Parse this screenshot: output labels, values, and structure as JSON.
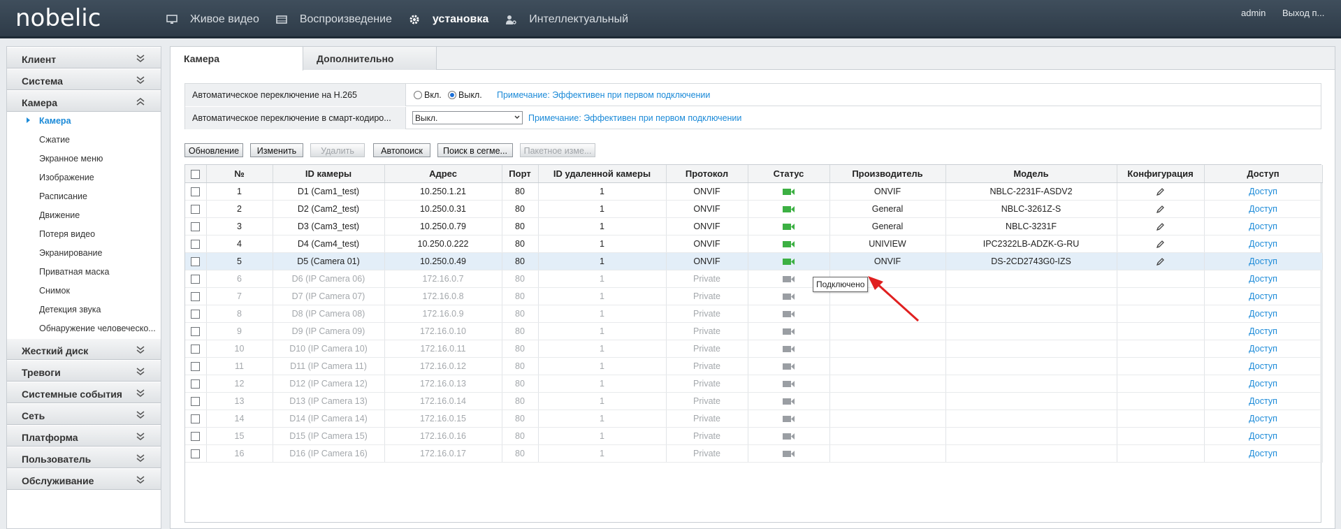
{
  "header": {
    "logo": "nobelic",
    "nav": [
      {
        "label": "Живое видео",
        "icon": "monitor-icon"
      },
      {
        "label": "Воспроизведение",
        "icon": "film-icon"
      },
      {
        "label": "установка",
        "icon": "gear-icon",
        "active": true
      },
      {
        "label": "Интеллектуальный",
        "icon": "user-settings-icon"
      }
    ],
    "user": "admin",
    "logout": "Выход п..."
  },
  "sidebar": {
    "sections_top": [
      {
        "label": "Клиент"
      },
      {
        "label": "Система"
      },
      {
        "label": "Камера",
        "expanded": true
      }
    ],
    "camera_items": [
      {
        "label": "Камера",
        "active": true
      },
      {
        "label": "Сжатие"
      },
      {
        "label": "Экранное меню"
      },
      {
        "label": "Изображение"
      },
      {
        "label": "Расписание"
      },
      {
        "label": "Движение"
      },
      {
        "label": "Потеря видео"
      },
      {
        "label": "Экранирование"
      },
      {
        "label": "Приватная маска"
      },
      {
        "label": "Снимок"
      },
      {
        "label": "Детекция звука"
      },
      {
        "label": "Обнаружение человеческо..."
      }
    ],
    "sections_bottom": [
      {
        "label": "Жесткий диск"
      },
      {
        "label": "Тревоги"
      },
      {
        "label": "Системные события"
      },
      {
        "label": "Сеть"
      },
      {
        "label": "Платформа"
      },
      {
        "label": "Пользователь"
      },
      {
        "label": "Обслуживание"
      }
    ]
  },
  "tabs": [
    {
      "label": "Камера",
      "active": true
    },
    {
      "label": "Дополнительно"
    }
  ],
  "options": {
    "h265_label": "Автоматическое переключение на H.265",
    "h265_on_label": "Вкл.",
    "h265_off_label": "Выкл.",
    "h265_value": "off",
    "h265_note": "Примечание: Эффективен при первом подключении",
    "smart_label": "Автоматическое переключение в смарт-кодиро...",
    "smart_value": "Выкл.",
    "smart_note": "Примечание: Эффективен при первом подключении"
  },
  "toolbar": {
    "refresh": "Обновление",
    "edit": "Изменить",
    "delete": "Удалить",
    "autosearch": "Автопоиск",
    "segment_search": "Поиск в сегме...",
    "batch_edit": "Пакетное изме..."
  },
  "table": {
    "columns": [
      "№",
      "ID камеры",
      "Адрес",
      "Порт",
      "ID удаленной камеры",
      "Протокол",
      "Статус",
      "Производитель",
      "Модель",
      "Конфигурация",
      "Доступ"
    ],
    "rows": [
      {
        "no": "1",
        "id": "D1 (Cam1_test)",
        "addr": "10.250.1.21",
        "port": "80",
        "remote": "1",
        "proto": "ONVIF",
        "online": true,
        "vendor": "ONVIF",
        "model": "NBLC-2231F-ASDV2",
        "config": true,
        "access": "Доступ"
      },
      {
        "no": "2",
        "id": "D2 (Cam2_test)",
        "addr": "10.250.0.31",
        "port": "80",
        "remote": "1",
        "proto": "ONVIF",
        "online": true,
        "vendor": "General",
        "model": "NBLC-3261Z-S",
        "config": true,
        "access": "Доступ"
      },
      {
        "no": "3",
        "id": "D3 (Cam3_test)",
        "addr": "10.250.0.79",
        "port": "80",
        "remote": "1",
        "proto": "ONVIF",
        "online": true,
        "vendor": "General",
        "model": "NBLC-3231F",
        "config": true,
        "access": "Доступ"
      },
      {
        "no": "4",
        "id": "D4 (Cam4_test)",
        "addr": "10.250.0.222",
        "port": "80",
        "remote": "1",
        "proto": "ONVIF",
        "online": true,
        "vendor": "UNIVIEW",
        "model": "IPC2322LB-ADZK-G-RU",
        "config": true,
        "access": "Доступ"
      },
      {
        "no": "5",
        "id": "D5 (Camera 01)",
        "addr": "10.250.0.49",
        "port": "80",
        "remote": "1",
        "proto": "ONVIF",
        "online": true,
        "vendor": "ONVIF",
        "model": "DS-2CD2743G0-IZS",
        "config": true,
        "access": "Доступ",
        "selected": true
      },
      {
        "no": "6",
        "id": "D6 (IP Camera 06)",
        "addr": "172.16.0.7",
        "port": "80",
        "remote": "1",
        "proto": "Private",
        "online": false,
        "vendor": "",
        "model": "",
        "config": false,
        "access": "Доступ"
      },
      {
        "no": "7",
        "id": "D7 (IP Camera 07)",
        "addr": "172.16.0.8",
        "port": "80",
        "remote": "1",
        "proto": "Private",
        "online": false,
        "vendor": "",
        "model": "",
        "config": false,
        "access": "Доступ"
      },
      {
        "no": "8",
        "id": "D8 (IP Camera 08)",
        "addr": "172.16.0.9",
        "port": "80",
        "remote": "1",
        "proto": "Private",
        "online": false,
        "vendor": "",
        "model": "",
        "config": false,
        "access": "Доступ"
      },
      {
        "no": "9",
        "id": "D9 (IP Camera 09)",
        "addr": "172.16.0.10",
        "port": "80",
        "remote": "1",
        "proto": "Private",
        "online": false,
        "vendor": "",
        "model": "",
        "config": false,
        "access": "Доступ"
      },
      {
        "no": "10",
        "id": "D10 (IP Camera 10)",
        "addr": "172.16.0.11",
        "port": "80",
        "remote": "1",
        "proto": "Private",
        "online": false,
        "vendor": "",
        "model": "",
        "config": false,
        "access": "Доступ"
      },
      {
        "no": "11",
        "id": "D11 (IP Camera 11)",
        "addr": "172.16.0.12",
        "port": "80",
        "remote": "1",
        "proto": "Private",
        "online": false,
        "vendor": "",
        "model": "",
        "config": false,
        "access": "Доступ"
      },
      {
        "no": "12",
        "id": "D12 (IP Camera 12)",
        "addr": "172.16.0.13",
        "port": "80",
        "remote": "1",
        "proto": "Private",
        "online": false,
        "vendor": "",
        "model": "",
        "config": false,
        "access": "Доступ"
      },
      {
        "no": "13",
        "id": "D13 (IP Camera 13)",
        "addr": "172.16.0.14",
        "port": "80",
        "remote": "1",
        "proto": "Private",
        "online": false,
        "vendor": "",
        "model": "",
        "config": false,
        "access": "Доступ"
      },
      {
        "no": "14",
        "id": "D14 (IP Camera 14)",
        "addr": "172.16.0.15",
        "port": "80",
        "remote": "1",
        "proto": "Private",
        "online": false,
        "vendor": "",
        "model": "",
        "config": false,
        "access": "Доступ"
      },
      {
        "no": "15",
        "id": "D15 (IP Camera 15)",
        "addr": "172.16.0.16",
        "port": "80",
        "remote": "1",
        "proto": "Private",
        "online": false,
        "vendor": "",
        "model": "",
        "config": false,
        "access": "Доступ"
      },
      {
        "no": "16",
        "id": "D16 (IP Camera 16)",
        "addr": "172.16.0.17",
        "port": "80",
        "remote": "1",
        "proto": "Private",
        "online": false,
        "vendor": "",
        "model": "",
        "config": false,
        "access": "Доступ"
      }
    ]
  },
  "tooltip": "Подключено",
  "colors": {
    "accent": "#1b8ad8",
    "online": "#3cb043",
    "offline": "#9a9ea3",
    "annotation_arrow": "#e02020"
  }
}
